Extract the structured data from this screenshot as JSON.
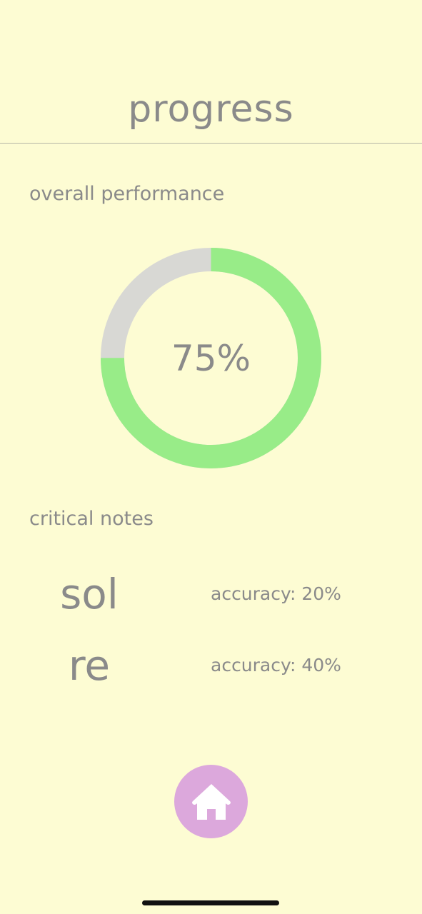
{
  "header": {
    "title": "progress"
  },
  "performance": {
    "label": "overall performance",
    "percent_text": "75%",
    "fraction": 0.75,
    "fill_color": "#98ec88",
    "track_color": "#d8d8d4"
  },
  "critical_notes": {
    "label": "critical notes",
    "items": [
      {
        "note": "sol",
        "accuracy": "accuracy: 20%"
      },
      {
        "note": "re",
        "accuracy": "accuracy: 40%"
      }
    ]
  },
  "nav": {
    "home_icon": "home-icon",
    "home_color": "#dca8dc"
  },
  "colors": {
    "background": "#fdfcd3",
    "text": "#8a8a8a"
  }
}
